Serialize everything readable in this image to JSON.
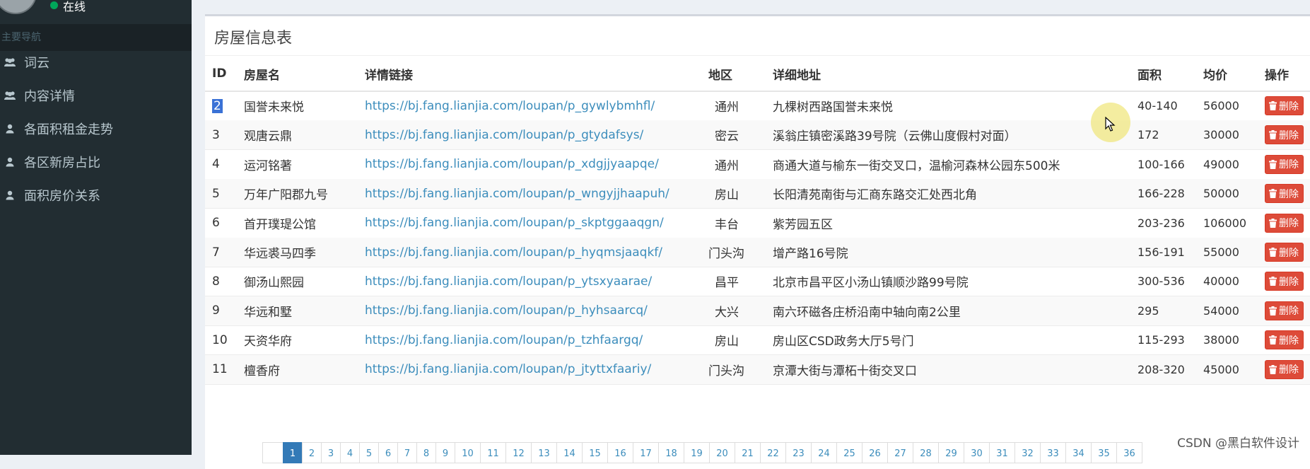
{
  "sidebar": {
    "status_text": "在线",
    "nav_header": "主要导航",
    "items": [
      {
        "label": "词云",
        "icon": "users-icon"
      },
      {
        "label": "内容详情",
        "icon": "users-icon"
      },
      {
        "label": "各面积租金走势",
        "icon": "user-icon"
      },
      {
        "label": "各区新房占比",
        "icon": "user-icon"
      },
      {
        "label": "面积房价关系",
        "icon": "user-icon"
      }
    ]
  },
  "main": {
    "title": "房屋信息表",
    "columns": [
      "ID",
      "房屋名",
      "详情链接",
      "地区",
      "详细地址",
      "面积",
      "均价",
      "操作"
    ],
    "delete_label": "删除",
    "rows": [
      {
        "id": "2",
        "name": "国誉未来悦",
        "link": "https://bj.fang.lianjia.com/loupan/p_gywlybmhfl/",
        "district": "通州",
        "address": "九棵树西路国誉未来悦",
        "area": "40-140",
        "price": "56000"
      },
      {
        "id": "3",
        "name": "观唐云鼎",
        "link": "https://bj.fang.lianjia.com/loupan/p_gtydafsys/",
        "district": "密云",
        "address": "溪翁庄镇密溪路39号院（云佛山度假村对面）",
        "area": "172",
        "price": "30000"
      },
      {
        "id": "4",
        "name": "运河铭著",
        "link": "https://bj.fang.lianjia.com/loupan/p_xdgjjyaapqe/",
        "district": "通州",
        "address": "商通大道与榆东一街交叉口，温榆河森林公园东500米",
        "area": "100-166",
        "price": "49000"
      },
      {
        "id": "5",
        "name": "万年广阳郡九号",
        "link": "https://bj.fang.lianjia.com/loupan/p_wngyjjhaapuh/",
        "district": "房山",
        "address": "长阳清苑南街与汇商东路交汇处西北角",
        "area": "166-228",
        "price": "50000"
      },
      {
        "id": "6",
        "name": "首开璞瑅公馆",
        "link": "https://bj.fang.lianjia.com/loupan/p_skptggaaqgn/",
        "district": "丰台",
        "address": "紫芳园五区",
        "area": "203-236",
        "price": "106000"
      },
      {
        "id": "7",
        "name": "华远裘马四季",
        "link": "https://bj.fang.lianjia.com/loupan/p_hyqmsjaaqkf/",
        "district": "门头沟",
        "address": "增产路16号院",
        "area": "156-191",
        "price": "55000"
      },
      {
        "id": "8",
        "name": "御汤山熙园",
        "link": "https://bj.fang.lianjia.com/loupan/p_ytsxyaarae/",
        "district": "昌平",
        "address": "北京市昌平区小汤山镇顺沙路99号院",
        "area": "300-536",
        "price": "40000"
      },
      {
        "id": "9",
        "name": "华远和墅",
        "link": "https://bj.fang.lianjia.com/loupan/p_hyhsaarcq/",
        "district": "大兴",
        "address": "南六环磁各庄桥沿南中轴向南2公里",
        "area": "295",
        "price": "54000"
      },
      {
        "id": "10",
        "name": "天资华府",
        "link": "https://bj.fang.lianjia.com/loupan/p_tzhfaargq/",
        "district": "房山",
        "address": "房山区CSD政务大厅5号门",
        "area": "115-293",
        "price": "38000"
      },
      {
        "id": "11",
        "name": "檀香府",
        "link": "https://bj.fang.lianjia.com/loupan/p_jtyttxfaariy/",
        "district": "门头沟",
        "address": "京潭大街与潭柘十街交叉口",
        "area": "208-320",
        "price": "45000"
      }
    ],
    "pagination": [
      "1",
      "2",
      "3",
      "4",
      "5",
      "6",
      "7",
      "8",
      "9",
      "10",
      "11",
      "12",
      "13",
      "14",
      "15",
      "16",
      "17",
      "18",
      "19",
      "20",
      "21",
      "22",
      "23",
      "24",
      "25",
      "26",
      "27",
      "28",
      "29",
      "30",
      "31",
      "32",
      "33",
      "34",
      "35",
      "36"
    ],
    "active_page": "1"
  },
  "watermark": "CSDN @黑白软件设计",
  "colors": {
    "sidebar_bg": "#222d32",
    "link": "#3c8dbc",
    "delete": "#dd4b39",
    "active_page": "#337ab7"
  }
}
